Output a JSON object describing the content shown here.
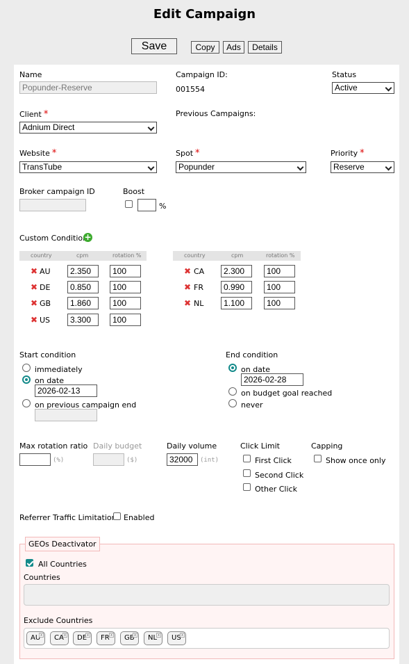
{
  "page_title": "Edit Campaign",
  "toolbar": {
    "save": "Save",
    "copy": "Copy",
    "ads": "Ads",
    "details": "Details"
  },
  "labels": {
    "name": "Name",
    "campaign_id": "Campaign ID:",
    "status": "Status",
    "client": "Client",
    "previous_campaigns": "Previous Campaigns:",
    "website": "Website",
    "spot": "Spot",
    "priority": "Priority",
    "broker_campaign_id": "Broker campaign ID",
    "boost": "Boost",
    "percent": "%",
    "custom_conditions": "Custom Conditions",
    "start_condition": "Start condition",
    "end_condition": "End condition",
    "max_rotation_ratio": "Max rotation ratio",
    "daily_budget": "Daily budget",
    "daily_volume": "Daily volume",
    "click_limit": "Click Limit",
    "capping": "Capping",
    "unit_percent": "(%)",
    "unit_dollar": "($)",
    "unit_int": "(int)",
    "referrer_traffic_limitation": "Referrer Traffic Limitation:",
    "enabled": "Enabled",
    "geos_deactivator": "GEOs Deactivator",
    "all_countries": "All Countries",
    "countries": "Countries",
    "exclude_countries": "Exclude Countries",
    "required_mark": "*"
  },
  "values": {
    "name": "Popunder-Reserve",
    "campaign_id": "001554",
    "status": "Active",
    "client": "Adnium Direct",
    "website": "TransTube",
    "spot": "Popunder",
    "priority": "Reserve",
    "broker_campaign_id": "",
    "boost": "",
    "max_rotation_ratio": "",
    "daily_budget": "",
    "daily_volume": "32000"
  },
  "custom_conditions": {
    "headers": {
      "country": "country",
      "cpm": "cpm",
      "rotation": "rotation %"
    },
    "left": [
      {
        "country": "AU",
        "cpm": "2.350",
        "rotation": "100"
      },
      {
        "country": "DE",
        "cpm": "0.850",
        "rotation": "100"
      },
      {
        "country": "GB",
        "cpm": "1.860",
        "rotation": "100"
      },
      {
        "country": "US",
        "cpm": "3.300",
        "rotation": "100"
      }
    ],
    "right": [
      {
        "country": "CA",
        "cpm": "2.300",
        "rotation": "100"
      },
      {
        "country": "FR",
        "cpm": "0.990",
        "rotation": "100"
      },
      {
        "country": "NL",
        "cpm": "1.100",
        "rotation": "100"
      }
    ]
  },
  "start": {
    "immediately": "immediately",
    "on_date": "on date",
    "date": "2026-02-13",
    "on_previous_end": "on previous campaign end",
    "selected": "on_date"
  },
  "end": {
    "on_date": "on date",
    "date": "2026-02-28",
    "on_budget": "on budget goal reached",
    "never": "never",
    "selected": "on_date"
  },
  "click_limit": {
    "first": "First Click",
    "second": "Second Click",
    "other": "Other Click"
  },
  "capping": {
    "show_once": "Show once only"
  },
  "exclude_tags": [
    "AU",
    "CA",
    "DE",
    "FR",
    "GB",
    "NL",
    "US"
  ],
  "colors": {
    "accent": "#138a8a",
    "required": "#dd0000",
    "remove": "#dd3333",
    "geo_bg": "#fff4f4"
  }
}
